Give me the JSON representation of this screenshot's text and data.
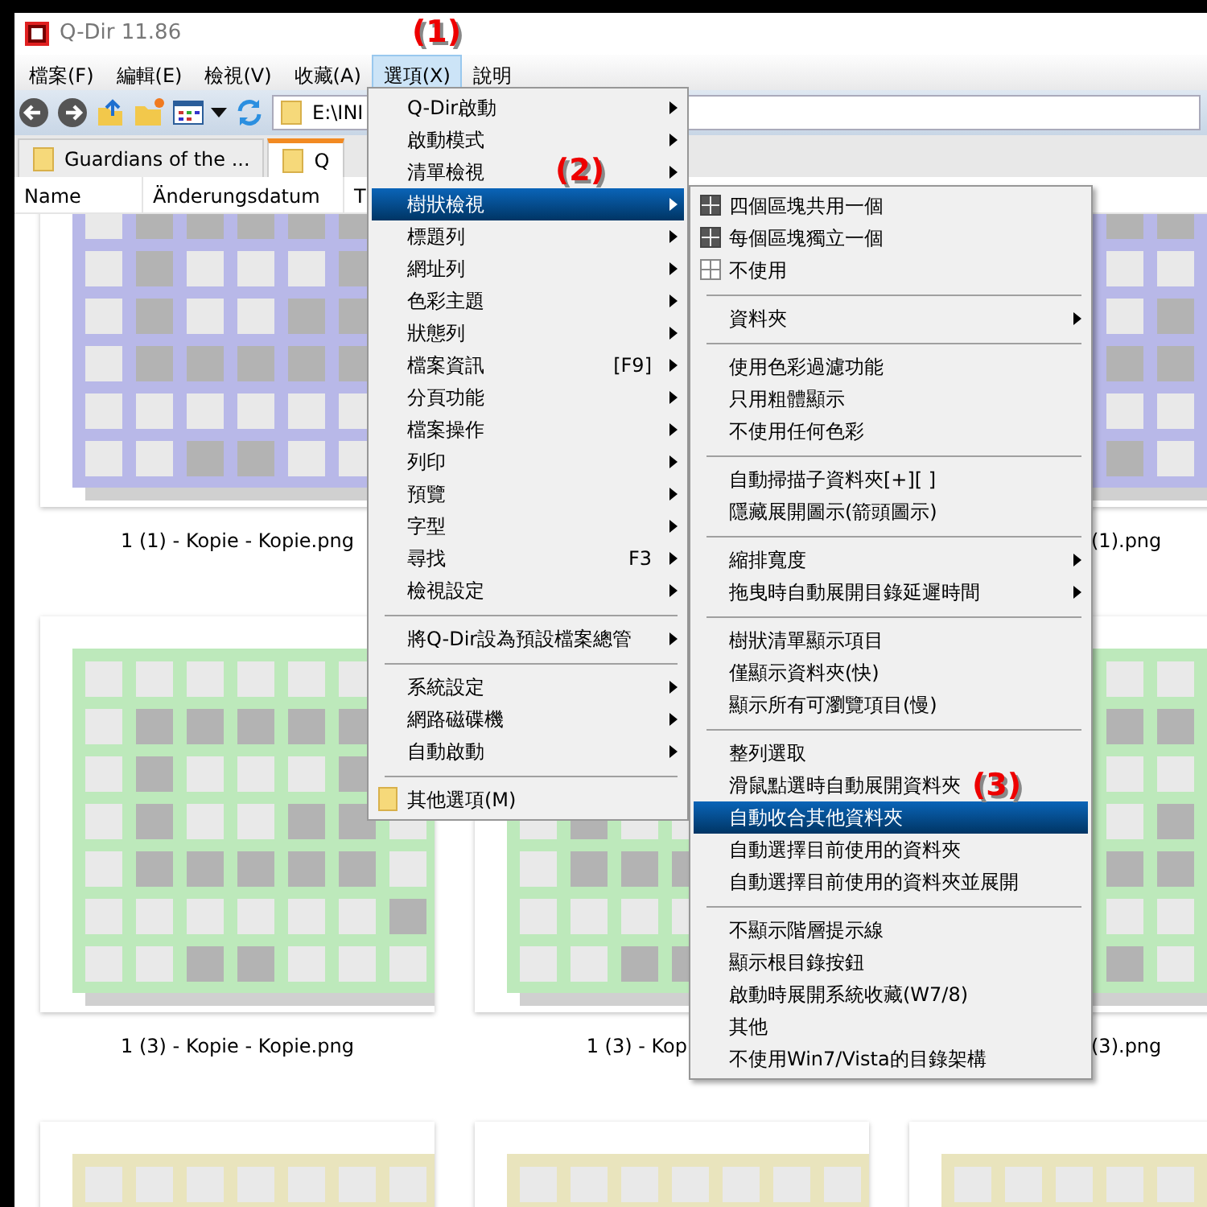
{
  "window": {
    "title": "Q-Dir 11.86"
  },
  "menu_bar": [
    {
      "label": "檔案(F)",
      "selected": false
    },
    {
      "label": "編輯(E)",
      "selected": false
    },
    {
      "label": "檢視(V)",
      "selected": false
    },
    {
      "label": "收藏(A)",
      "selected": false
    },
    {
      "label": "選項(X)",
      "selected": true
    },
    {
      "label": "說明",
      "selected": false
    }
  ],
  "address": {
    "value": "E:\\INI"
  },
  "tabs": [
    {
      "label": "Guardians of the ...",
      "selected": false
    },
    {
      "label": "Q",
      "selected": true
    }
  ],
  "columns": [
    "Name",
    "Änderungsdatum",
    "T"
  ],
  "thumbnails": [
    {
      "label": "1 (1) - Kopie - Kopie.png",
      "color": "#b8b8e8"
    },
    {
      "label": "(1).png",
      "color": "#b8b8e8"
    },
    {
      "label": "1 (3) - Kopie - Kopie.png",
      "color": "#bde9bb"
    },
    {
      "label": "1 (3) - Kop",
      "color": "#bde9bb"
    },
    {
      "label": "(3).png",
      "color": "#bde9bb"
    },
    {
      "color": "#e9e4bd"
    },
    {
      "color": "#e9e4bd"
    },
    {
      "color": "#e9e4bd"
    }
  ],
  "options_menu": {
    "items": [
      {
        "kind": "item",
        "label": "Q-Dir啟動",
        "submenu": true,
        "selected": false
      },
      {
        "kind": "item",
        "label": "啟動模式",
        "submenu": true,
        "selected": false
      },
      {
        "kind": "item",
        "label": "清單檢視",
        "submenu": true,
        "selected": false
      },
      {
        "kind": "item",
        "label": "樹狀檢視",
        "submenu": true,
        "selected": true
      },
      {
        "kind": "item",
        "label": "標題列",
        "submenu": true,
        "selected": false
      },
      {
        "kind": "item",
        "label": "網址列",
        "submenu": true,
        "selected": false
      },
      {
        "kind": "item",
        "label": "色彩主題",
        "submenu": true,
        "selected": false
      },
      {
        "kind": "item",
        "label": "狀態列",
        "submenu": true,
        "selected": false
      },
      {
        "kind": "item",
        "label": "檔案資訊",
        "shortcut": "[F9]",
        "submenu": true,
        "selected": false
      },
      {
        "kind": "item",
        "label": "分頁功能",
        "submenu": true,
        "selected": false
      },
      {
        "kind": "item",
        "label": "檔案操作",
        "submenu": true,
        "selected": false
      },
      {
        "kind": "item",
        "label": "列印",
        "submenu": true,
        "selected": false
      },
      {
        "kind": "item",
        "label": "預覽",
        "submenu": true,
        "selected": false
      },
      {
        "kind": "item",
        "label": "字型",
        "submenu": true,
        "selected": false
      },
      {
        "kind": "item",
        "label": "尋找",
        "shortcut": "F3",
        "submenu": true,
        "selected": false
      },
      {
        "kind": "item",
        "label": "檢視設定",
        "submenu": true,
        "selected": false
      },
      {
        "kind": "separator"
      },
      {
        "kind": "item",
        "label": "將Q-Dir設為預設檔案總管",
        "submenu": true,
        "selected": false
      },
      {
        "kind": "separator"
      },
      {
        "kind": "item",
        "label": "系統設定",
        "submenu": true,
        "selected": false
      },
      {
        "kind": "item",
        "label": "網路磁碟機",
        "submenu": true,
        "selected": false
      },
      {
        "kind": "item",
        "label": "自動啟動",
        "submenu": true,
        "selected": false
      },
      {
        "kind": "separator"
      },
      {
        "kind": "folder-item",
        "label": "其他選項(M)",
        "submenu": false,
        "selected": false
      }
    ]
  },
  "tree_view_submenu": {
    "items": [
      {
        "kind": "shaded",
        "label": "四個區塊共用一個",
        "submenu": false,
        "selected": false
      },
      {
        "kind": "shaded",
        "label": "每個區塊獨立一個",
        "submenu": false,
        "selected": false
      },
      {
        "kind": "outlined",
        "label": "不使用",
        "submenu": false,
        "selected": false
      },
      {
        "kind": "separator"
      },
      {
        "kind": "item",
        "label": "資料夾",
        "submenu": true,
        "selected": false
      },
      {
        "kind": "separator"
      },
      {
        "kind": "item",
        "label": "使用色彩過濾功能",
        "submenu": false,
        "selected": false
      },
      {
        "kind": "item",
        "label": "只用粗體顯示",
        "submenu": false,
        "selected": false
      },
      {
        "kind": "item",
        "label": "不使用任何色彩",
        "submenu": false,
        "selected": false
      },
      {
        "kind": "separator"
      },
      {
        "kind": "item",
        "label": "自動掃描子資料夾[+][ ]",
        "submenu": false,
        "selected": false
      },
      {
        "kind": "item",
        "label": "隱藏展開圖示(箭頭圖示)",
        "submenu": false,
        "selected": false
      },
      {
        "kind": "separator"
      },
      {
        "kind": "item",
        "label": "縮排寬度",
        "submenu": true,
        "selected": false
      },
      {
        "kind": "item",
        "label": "拖曳時自動展開目錄延遲時間",
        "submenu": true,
        "selected": false
      },
      {
        "kind": "separator"
      },
      {
        "kind": "item",
        "label": "樹狀清單顯示項目",
        "submenu": false,
        "selected": false
      },
      {
        "kind": "item",
        "label": "僅顯示資料夾(快)",
        "submenu": false,
        "selected": false
      },
      {
        "kind": "item",
        "label": "顯示所有可瀏覽項目(慢)",
        "submenu": false,
        "selected": false
      },
      {
        "kind": "separator"
      },
      {
        "kind": "item",
        "label": "整列選取",
        "submenu": false,
        "selected": false
      },
      {
        "kind": "item",
        "label": "滑鼠點選時自動展開資料夾",
        "submenu": false,
        "selected": false
      },
      {
        "kind": "item",
        "label": "自動收合其他資料夾",
        "submenu": false,
        "selected": true
      },
      {
        "kind": "item",
        "label": "自動選擇目前使用的資料夾",
        "submenu": false,
        "selected": false
      },
      {
        "kind": "item",
        "label": "自動選擇目前使用的資料夾並展開",
        "submenu": false,
        "selected": false
      },
      {
        "kind": "separator"
      },
      {
        "kind": "item",
        "label": "不顯示階層提示線",
        "submenu": false,
        "selected": false
      },
      {
        "kind": "item",
        "label": "顯示根目錄按鈕",
        "submenu": false,
        "selected": false
      },
      {
        "kind": "item",
        "label": "啟動時展開系統收藏(W7/8)",
        "submenu": false,
        "selected": false
      },
      {
        "kind": "item",
        "label": "其他",
        "submenu": false,
        "selected": false
      },
      {
        "kind": "item",
        "label": "不使用Win7/Vista的目錄架構",
        "submenu": false,
        "selected": false
      }
    ]
  },
  "annotations": [
    "(1)",
    "(2)",
    "(3)"
  ]
}
